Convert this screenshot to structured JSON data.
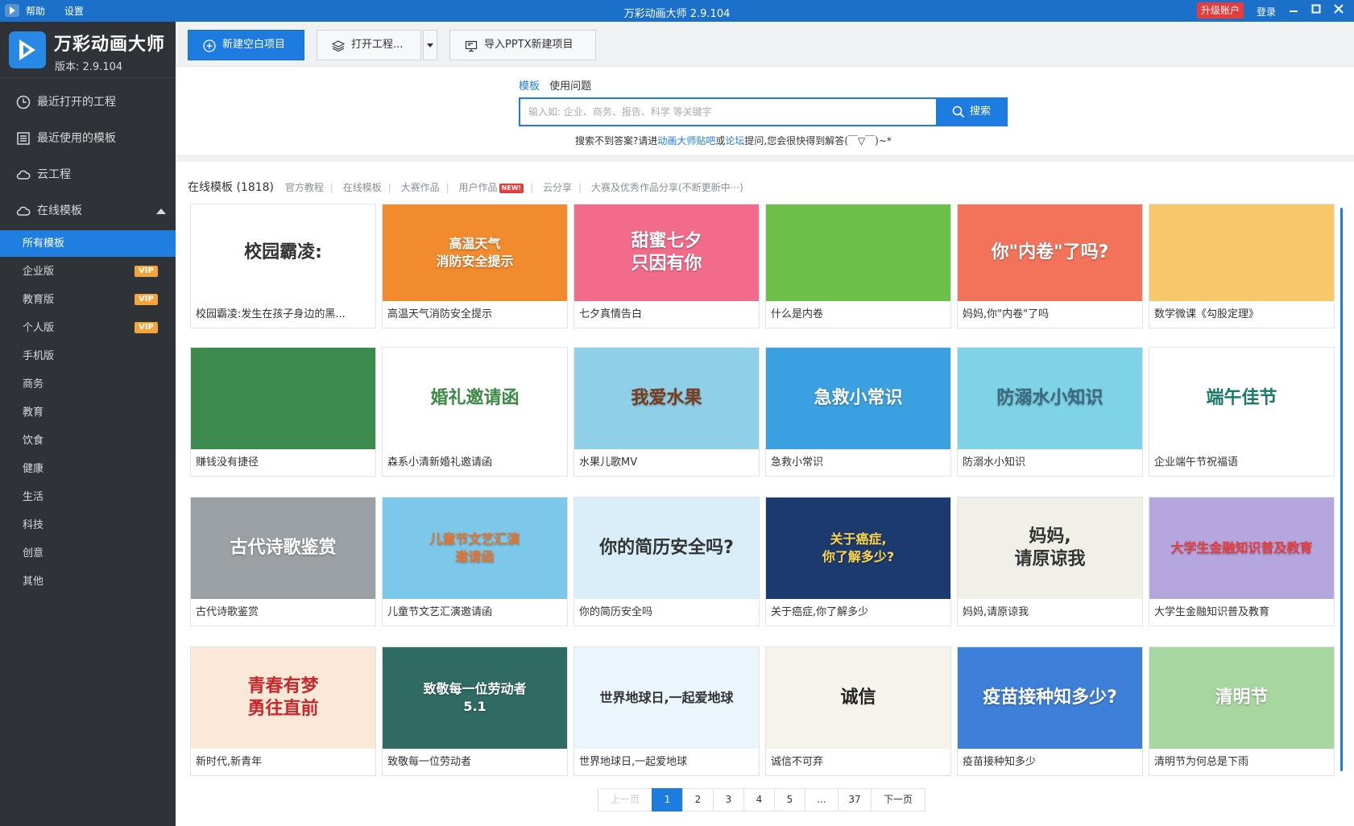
{
  "titlebar": {
    "title": "万彩动画大师 2.9.104",
    "menu": [
      "帮助",
      "设置"
    ],
    "upgrade": "升级账户",
    "login": "登录"
  },
  "brand": {
    "name": "万彩动画大师",
    "version": "版本: 2.9.104"
  },
  "nav": {
    "recent_projects": "最近打开的工程",
    "recent_templates": "最近使用的模板",
    "cloud": "云工程",
    "online": "在线模板"
  },
  "categories": [
    {
      "label": "所有模板",
      "vip": ""
    },
    {
      "label": "企业版",
      "vip": "VIP"
    },
    {
      "label": "教育版",
      "vip": "VIP"
    },
    {
      "label": "个人版",
      "vip": "VIP"
    },
    {
      "label": "手机版",
      "vip": ""
    },
    {
      "label": "商务",
      "vip": ""
    },
    {
      "label": "教育",
      "vip": ""
    },
    {
      "label": "饮食",
      "vip": ""
    },
    {
      "label": "健康",
      "vip": ""
    },
    {
      "label": "生活",
      "vip": ""
    },
    {
      "label": "科技",
      "vip": ""
    },
    {
      "label": "创意",
      "vip": ""
    },
    {
      "label": "其他",
      "vip": ""
    }
  ],
  "toolbar": {
    "new_blank": "新建空白项目",
    "open_project": "打开工程...",
    "import_pptx": "导入PPTX新建项目"
  },
  "search": {
    "tab_template": "模板",
    "tab_question": "使用问题",
    "placeholder": "输入如: 企业、商务、报告、科学 等关键字",
    "button": "搜索",
    "hint_prefix": "搜索不到答案?请进",
    "hint_link1": "动画大师贴吧",
    "hint_or": "或",
    "hint_link2": "论坛",
    "hint_suffix": "提问,您会很快得到解答(￣▽￣)~*"
  },
  "filter": {
    "main": "在线模板 (1818)",
    "tabs": [
      "官方教程",
      "在线模板",
      "大赛作品",
      "用户作品",
      "云分享",
      "大赛及优秀作品分享(不断更新中···)"
    ],
    "new_badge": "NEW!"
  },
  "templates": [
    {
      "caption": "校园霸凌:发生在孩子身边的黑...",
      "art": "校园霸凌:",
      "bg": "#ffffff",
      "fg": "#333333"
    },
    {
      "caption": "高温天气消防安全提示",
      "art": "高温天气\n消防安全提示",
      "bg": "#f28a2e",
      "fg": "#ffffff"
    },
    {
      "caption": "七夕真情告白",
      "art": "甜蜜七夕\n只因有你",
      "bg": "#f36b8a",
      "fg": "#ffffff"
    },
    {
      "caption": "什么是内卷",
      "art": "",
      "bg": "#6cc04a",
      "fg": "#ffffff"
    },
    {
      "caption": "妈妈,你\"内卷\"了吗",
      "art": "你\"内卷\"了吗?",
      "bg": "#f2735a",
      "fg": "#ffffff"
    },
    {
      "caption": "数学微课《勾股定理》",
      "art": "",
      "bg": "#f6c86a",
      "fg": "#ffffff"
    },
    {
      "caption": "赚钱没有捷径",
      "art": "",
      "bg": "#3d8a4f",
      "fg": "#ffffff"
    },
    {
      "caption": "森系小清新婚礼邀请函",
      "art": "婚礼邀请函",
      "bg": "#ffffff",
      "fg": "#3b8a45"
    },
    {
      "caption": "水果儿歌MV",
      "art": "我爱水果",
      "bg": "#8fd0e8",
      "fg": "#7a3b1a"
    },
    {
      "caption": "急救小常识",
      "art": "急救小常识",
      "bg": "#3aa0e0",
      "fg": "#ffffff"
    },
    {
      "caption": "防溺水小知识",
      "art": "防溺水小知识",
      "bg": "#7fd3e6",
      "fg": "#3a6a80"
    },
    {
      "caption": "企业端午节祝福语",
      "art": "端午佳节",
      "bg": "#ffffff",
      "fg": "#1a7a6a"
    },
    {
      "caption": "古代诗歌鉴赏",
      "art": "古代诗歌鉴赏",
      "bg": "#9aa0a4",
      "fg": "#ffffff"
    },
    {
      "caption": "儿童节文艺汇演邀请函",
      "art": "儿童节文艺汇演\n邀请函",
      "bg": "#7cc8ea",
      "fg": "#e8732a"
    },
    {
      "caption": "你的简历安全吗",
      "art": "你的简历安全吗?",
      "bg": "#d9eef8",
      "fg": "#333333"
    },
    {
      "caption": "关于癌症,你了解多少",
      "art": "关于癌症,\n你了解多少?",
      "bg": "#1d3a6e",
      "fg": "#ffd84a"
    },
    {
      "caption": "妈妈,请原谅我",
      "art": "妈妈,\n请原谅我",
      "bg": "#f0f0e8",
      "fg": "#333333"
    },
    {
      "caption": "大学生金融知识普及教育",
      "art": "大学生金融知识普及教育",
      "bg": "#b6a6e0",
      "fg": "#e83b3b"
    },
    {
      "caption": "新时代,新青年",
      "art": "青春有梦\n勇往直前",
      "bg": "#fbe8d8",
      "fg": "#c8282a"
    },
    {
      "caption": "致敬每一位劳动者",
      "art": "致敬每一位劳动者\n5.1",
      "bg": "#2f6b62",
      "fg": "#ffffff"
    },
    {
      "caption": "世界地球日,一起爱地球",
      "art": "世界地球日,一起爱地球",
      "bg": "#eaf6fb",
      "fg": "#333333"
    },
    {
      "caption": "诚信不可弃",
      "art": "诚信",
      "bg": "#f6f3ea",
      "fg": "#222222"
    },
    {
      "caption": "疫苗接种知多少",
      "art": "疫苗接种知多少?",
      "bg": "#3d7fd9",
      "fg": "#ffffff"
    },
    {
      "caption": "清明节为何总是下雨",
      "art": "清明节",
      "bg": "#a8d6a0",
      "fg": "#ffffff"
    }
  ],
  "pager": {
    "prev": "上一页",
    "pages": [
      "1",
      "2",
      "3",
      "4",
      "5",
      "...",
      "37"
    ],
    "next": "下一页"
  }
}
